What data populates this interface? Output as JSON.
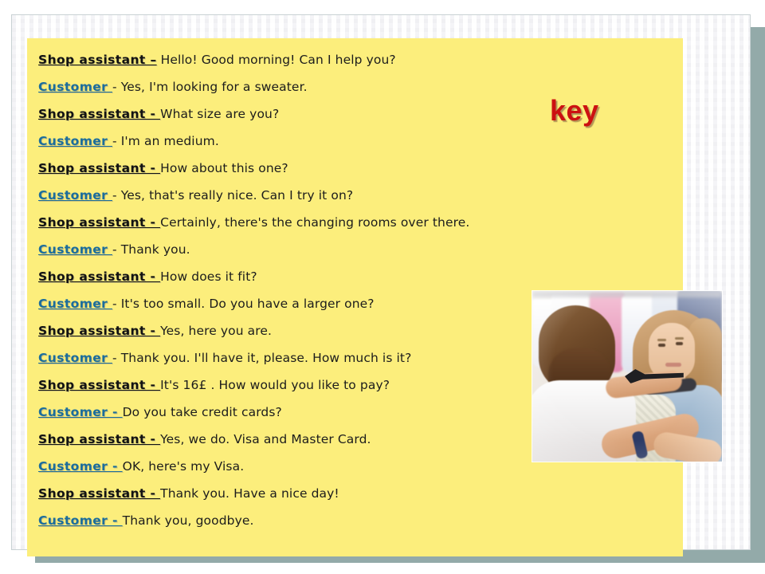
{
  "slide": {
    "heading": "key",
    "panel_color": "#fcee7c",
    "heading_color": "#cc1111",
    "customer_label_color": "#1b6d9c",
    "assistant_label_color": "#121212",
    "shadow_color": "#93aaa9"
  },
  "dialogue": {
    "lines": [
      {
        "speaker": "Shop assistant –",
        "role": "assistant",
        "text": "Hello! Good morning! Can I help you?"
      },
      {
        "speaker": "Customer ",
        "role": "customer",
        "text": "- Yes, I'm looking for a sweater."
      },
      {
        "speaker": "Shop assistant - ",
        "role": "assistant",
        "text": "What size are you?"
      },
      {
        "speaker": "Customer ",
        "role": "customer",
        "text": "-  I'm an medium."
      },
      {
        "speaker": "Shop assistant - ",
        "role": "assistant",
        "text": "How about this one?"
      },
      {
        "speaker": "Customer ",
        "role": "customer",
        "text": "- Yes, that's really nice. Can I try it on?"
      },
      {
        "speaker": "Shop assistant - ",
        "role": "assistant",
        "text": "Certainly, there's the changing rooms over there."
      },
      {
        "speaker": "Customer ",
        "role": "customer",
        "text": "-  Thank you."
      },
      {
        "speaker": "Shop assistant - ",
        "role": "assistant",
        "text": "How does it fit?"
      },
      {
        "speaker": "Customer ",
        "role": "customer",
        "text": "-  It's too small. Do you have a larger one?"
      },
      {
        "speaker": "Shop assistant - ",
        "role": "assistant",
        "text": "Yes, here you are."
      },
      {
        "speaker": "Customer ",
        "role": "customer",
        "text": "-  Thank you. I'll have it, please.  How much is it?"
      },
      {
        "speaker": "Shop assistant - ",
        "role": "assistant",
        "text": " It's 16£ . How would you like to pay?"
      },
      {
        "speaker": "Customer - ",
        "role": "customer",
        "text": "Do you take credit cards?"
      },
      {
        "speaker": "Shop assistant - ",
        "role": "assistant",
        "text": "Yes, we do. Visa and  Master Card."
      },
      {
        "speaker": "Customer - ",
        "role": "customer",
        "text": " OK, here's my Visa."
      },
      {
        "speaker": "Shop assistant - ",
        "role": "assistant",
        "text": " Thank you. Have a nice day!"
      },
      {
        "speaker": "Customer - ",
        "role": "customer",
        "text": "Thank you, goodbye."
      }
    ]
  },
  "photo": {
    "alt": "Shop assistant helping a young customer with a garment on a hanger in a clothing store"
  }
}
